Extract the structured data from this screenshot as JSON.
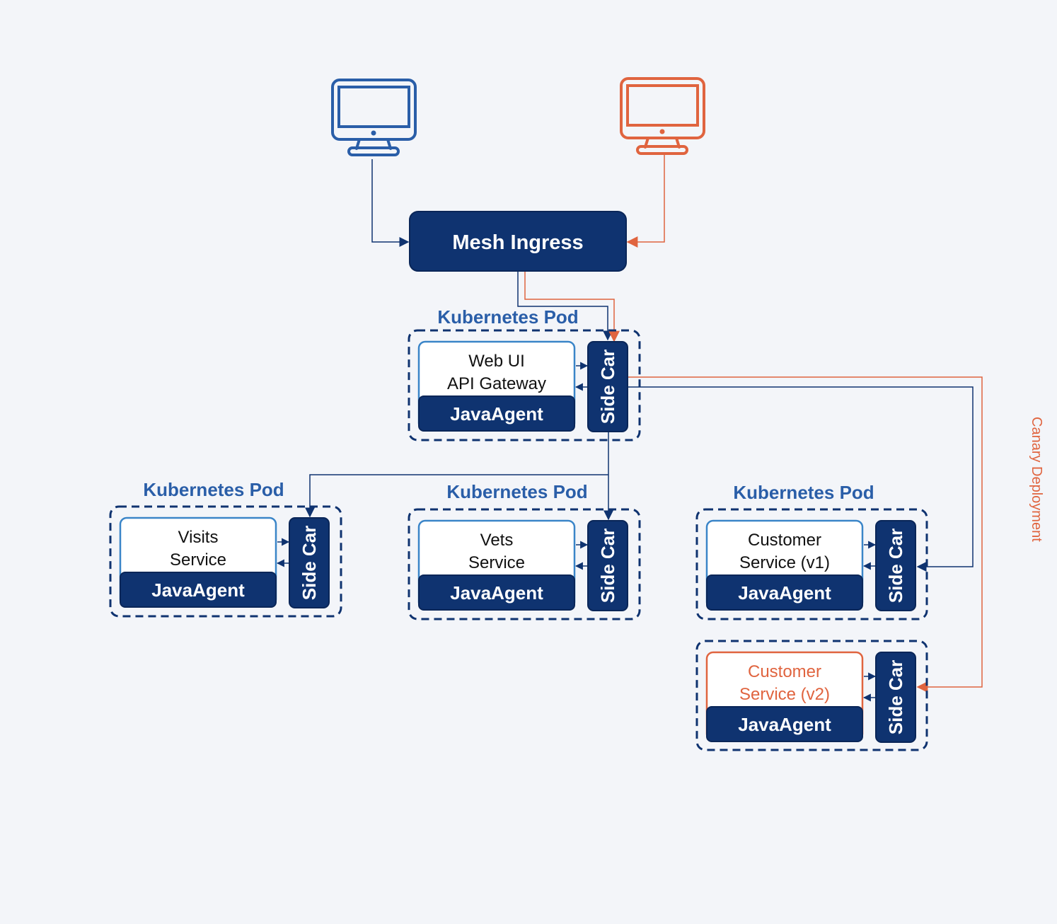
{
  "colors": {
    "background": "#f3f5f9",
    "navy": "#0f3370",
    "blue": "#2a5ea8",
    "orange": "#e0643f",
    "service_border_blue": "#3a85c8"
  },
  "clients": [
    {
      "name": "client-monitor-blue",
      "icon": "monitor-icon",
      "color": "blue"
    },
    {
      "name": "client-monitor-orange",
      "icon": "monitor-icon",
      "color": "orange"
    }
  ],
  "ingress": {
    "label": "Mesh Ingress"
  },
  "pods": {
    "gateway": {
      "title": "Kubernetes Pod",
      "service_lines": [
        "Web UI",
        "API Gateway"
      ],
      "agent": "JavaAgent",
      "sidecar": "Side Car"
    },
    "visits": {
      "title": "Kubernetes Pod",
      "service_lines": [
        "Visits",
        "Service"
      ],
      "agent": "JavaAgent",
      "sidecar": "Side Car"
    },
    "vets": {
      "title": "Kubernetes Pod",
      "service_lines": [
        "Vets",
        "Service"
      ],
      "agent": "JavaAgent",
      "sidecar": "Side Car"
    },
    "customer_v1": {
      "title": "Kubernetes Pod",
      "service_lines": [
        "Customer",
        "Service (v1)"
      ],
      "agent": "JavaAgent",
      "sidecar": "Side Car"
    },
    "customer_v2": {
      "title": "",
      "service_lines": [
        "Customer",
        "Service (v2)"
      ],
      "agent": "JavaAgent",
      "sidecar": "Side Car"
    }
  },
  "annotations": {
    "canary": "Canary Deployment"
  }
}
